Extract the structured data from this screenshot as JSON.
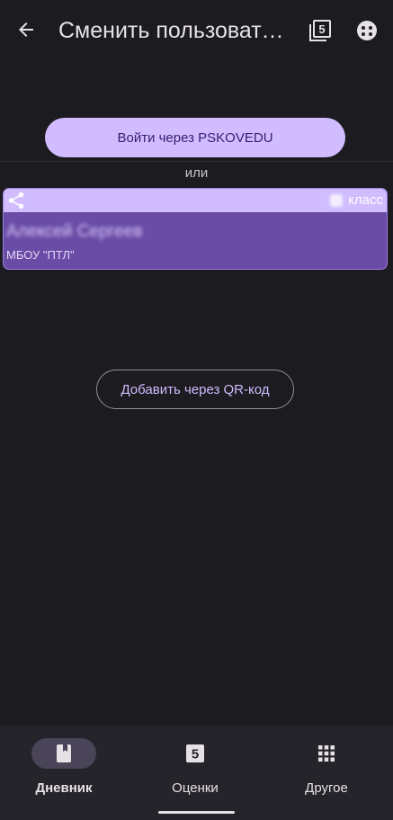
{
  "appbar": {
    "title": "Сменить пользователя",
    "back_icon": "arrow-back-icon",
    "action1_icon": "filter-5-icon",
    "action2_icon": "face-icon"
  },
  "login": {
    "label": "Войти через PSKOVEDU"
  },
  "or_text": "или",
  "account_card": {
    "class_label": "класс",
    "student_name": "Алексей Сергеев",
    "school": "МБОУ \"ПТЛ\""
  },
  "qr": {
    "label": "Добавить через QR-код"
  },
  "bottom_nav": {
    "items": [
      {
        "label": "Дневник",
        "icon": "diary-icon",
        "active": true
      },
      {
        "label": "Оценки",
        "icon": "grades-five-icon",
        "active": false
      },
      {
        "label": "Другое",
        "icon": "apps-grid-icon",
        "active": false
      }
    ]
  },
  "colors": {
    "background": "#1c1b1f",
    "accent": "#d0bcff",
    "card": "#6a4ba5",
    "nav_background": "#26242b"
  }
}
